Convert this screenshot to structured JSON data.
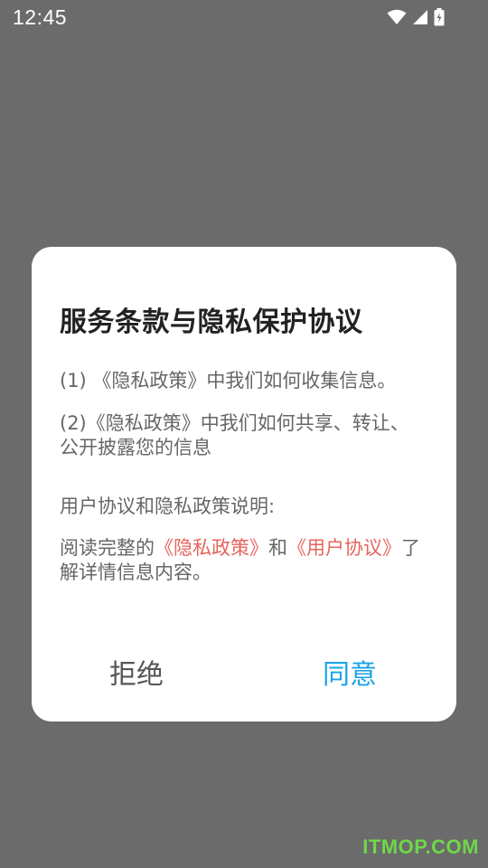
{
  "status_bar": {
    "time": "12:45",
    "icons": [
      "wifi-icon",
      "signal-icon",
      "battery-icon"
    ]
  },
  "dialog": {
    "title": "服务条款与隐私保护协议",
    "item1": "(1) 《隐私政策》中我们如何收集信息。",
    "item2": "(2)《隐私政策》中我们如何共享、转让、公开披露您的信息",
    "section_label": "用户协议和隐私政策说明:",
    "read_text_prefix": "阅读完整的",
    "privacy_link": "《隐私政策》",
    "connector": "和",
    "user_agreement_link": "《用户协议》",
    "read_text_suffix": "了解详情信息内容。",
    "refuse_label": "拒绝",
    "agree_label": "同意"
  },
  "watermark": "ITMOP.COM",
  "colors": {
    "overlay": "#6b6b6b",
    "link": "#e6645c",
    "agree": "#1aa3e8"
  }
}
